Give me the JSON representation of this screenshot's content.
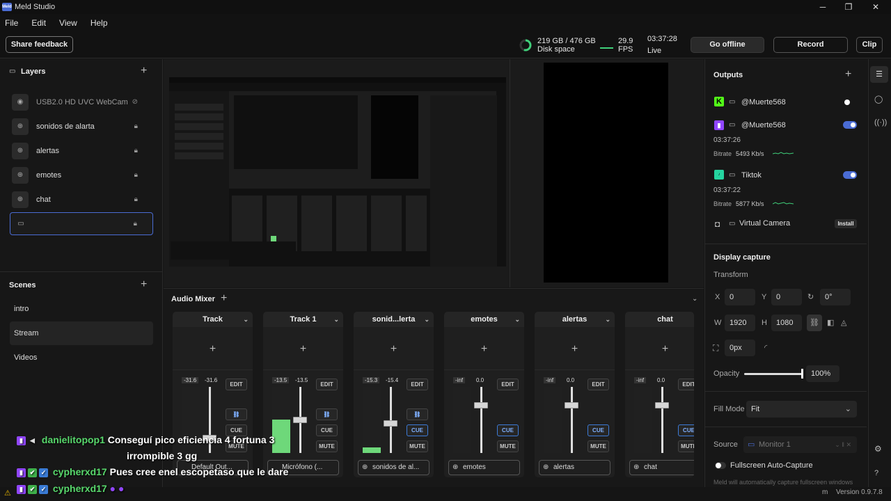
{
  "window": {
    "title": "Meld Studio",
    "logo_text": "Meld"
  },
  "menu": [
    "File",
    "Edit",
    "View",
    "Help"
  ],
  "toolbar": {
    "feedback_label": "Share feedback",
    "disk_value": "219 GB / 476 GB",
    "disk_label": "Disk space",
    "fps_value": "29.9",
    "fps_label": "FPS",
    "live_time": "03:37:28",
    "live_label": "Live",
    "offline_label": "Go offline",
    "record_label": "Record",
    "clip_label": "Clip"
  },
  "layers": {
    "title": "Layers",
    "items": [
      {
        "label": "USB2.0 HD UVC WebCam",
        "hidden": true
      },
      {
        "label": "sonidos de alarta"
      },
      {
        "label": "alertas"
      },
      {
        "label": "emotes"
      },
      {
        "label": "chat"
      },
      {
        "label": ""
      }
    ]
  },
  "scenes": {
    "title": "Scenes",
    "items": [
      "intro",
      "Stream",
      "Videos"
    ],
    "selected": "Stream"
  },
  "outputs": {
    "title": "Outputs",
    "kick": {
      "name": "@Muerte568"
    },
    "twitch": {
      "name": "@Muerte568",
      "time": "03:37:26",
      "bitrate_label": "Bitrate",
      "bitrate": "5493 Kb/s"
    },
    "tiktok": {
      "name": "Tiktok",
      "time": "03:37:22",
      "bitrate_label": "Bitrate",
      "bitrate": "5877 Kb/s"
    },
    "virtual": {
      "name": "Virtual Camera",
      "install_label": "Install"
    }
  },
  "display_capture": {
    "title": "Display capture",
    "transform_label": "Transform",
    "x_label": "X",
    "x": "0",
    "y_label": "Y",
    "y": "0",
    "rotation": "0°",
    "w_label": "W",
    "w": "1920",
    "h_label": "H",
    "h": "1080",
    "crop": "0px",
    "opacity_label": "Opacity",
    "opacity": "100%",
    "fill_label": "Fill Mode",
    "fill": "Fit",
    "source_label": "Source",
    "source": "Monitor 1",
    "fullscreen_label": "Fullscreen Auto-Capture",
    "fullscreen_note": "Meld will automatically capture fullscreen windows"
  },
  "mixer": {
    "title": "Audio Mixer",
    "strips": [
      {
        "name": "Track",
        "db_peak": "-31.6",
        "db_level": "-31.6",
        "source": "Default Out...",
        "cue_active": false
      },
      {
        "name": "Track 1",
        "db_peak": "-13.5",
        "db_level": "-13.5",
        "source": "Micrófono (...",
        "cue_active": false
      },
      {
        "name": "sonid...lerta",
        "db_peak": "-15.3",
        "db_level": "-15.4",
        "source": "sonidos de al...",
        "cue_active": true
      },
      {
        "name": "emotes",
        "db_peak": "-inf",
        "db_level": "0.0",
        "source": "emotes",
        "cue_active": true
      },
      {
        "name": "alertas",
        "db_peak": "-inf",
        "db_level": "0.0",
        "source": "alertas",
        "cue_active": true
      },
      {
        "name": "chat",
        "db_peak": "-inf",
        "db_level": "0.0",
        "source": "chat",
        "cue_active": true
      }
    ],
    "edit_label": "EDIT",
    "cue_label": "CUE",
    "mute_label": "MUTE"
  },
  "chat_overlay": [
    {
      "user": "danielitopop1",
      "message": "Conseguí pico eficiencia 4 fortuna 3",
      "message2": "irrompible 3 gg"
    },
    {
      "user": "cypherxd17",
      "message": "Pues cree enel escopetaso que le dare"
    },
    {
      "user": "cypherxd17",
      "message": ""
    }
  ],
  "version": "Version 0.9.7.8",
  "colors": {
    "accent": "#4a6cd4",
    "live_green": "#3fd07a",
    "chat_name": "#58d86c"
  }
}
